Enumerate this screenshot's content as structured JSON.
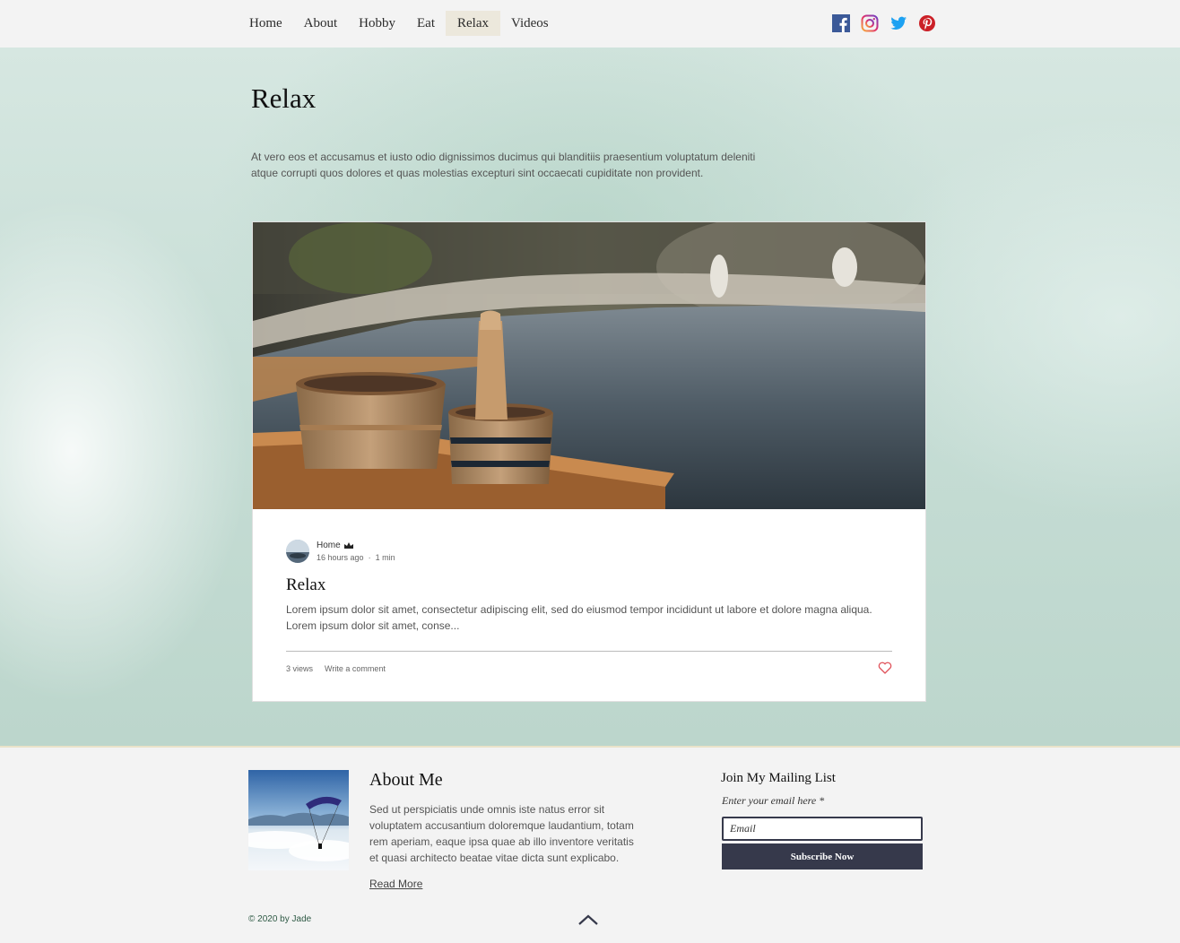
{
  "nav": {
    "items": [
      {
        "label": "Home"
      },
      {
        "label": "About"
      },
      {
        "label": "Hobby"
      },
      {
        "label": "Eat"
      },
      {
        "label": "Relax",
        "active": true
      },
      {
        "label": "Videos"
      }
    ]
  },
  "social": {
    "icons": [
      "facebook-icon",
      "instagram-icon",
      "twitter-icon",
      "pinterest-icon"
    ]
  },
  "page": {
    "title": "Relax",
    "description": "At vero eos et accusamus et iusto odio dignissimos ducimus qui blanditiis praesentium voluptatum deleniti atque corrupti quos dolores et quas molestias excepturi sint occaecati cupiditate non provident."
  },
  "post": {
    "author": "Home",
    "time_ago": "16 hours ago",
    "read_time": "1 min",
    "title": "Relax",
    "excerpt": "Lorem ipsum dolor sit amet, consectetur adipiscing elit, sed do eiusmod tempor incididunt ut labore et dolore magna aliqua. Lorem ipsum dolor sit amet, conse...",
    "views": "3 views",
    "comment_label": "Write a comment"
  },
  "footer": {
    "about_title": "About Me",
    "about_text": "Sed ut perspiciatis unde omnis iste natus error sit voluptatem accusantium doloremque laudantium, totam rem aperiam, eaque ipsa quae ab illo inventore veritatis et quasi architecto beatae vitae dicta sunt explicabo.",
    "read_more": "Read More",
    "mailing_title": "Join My Mailing List",
    "email_label": "Enter your email here *",
    "email_placeholder": "Email",
    "email_value": "",
    "subscribe_label": "Subscribe Now",
    "copyright": "© 2020 by Jade"
  },
  "colors": {
    "accent_dark": "#36394b",
    "heart": "#e0525a",
    "nav_active_bg": "#ece8dc"
  }
}
